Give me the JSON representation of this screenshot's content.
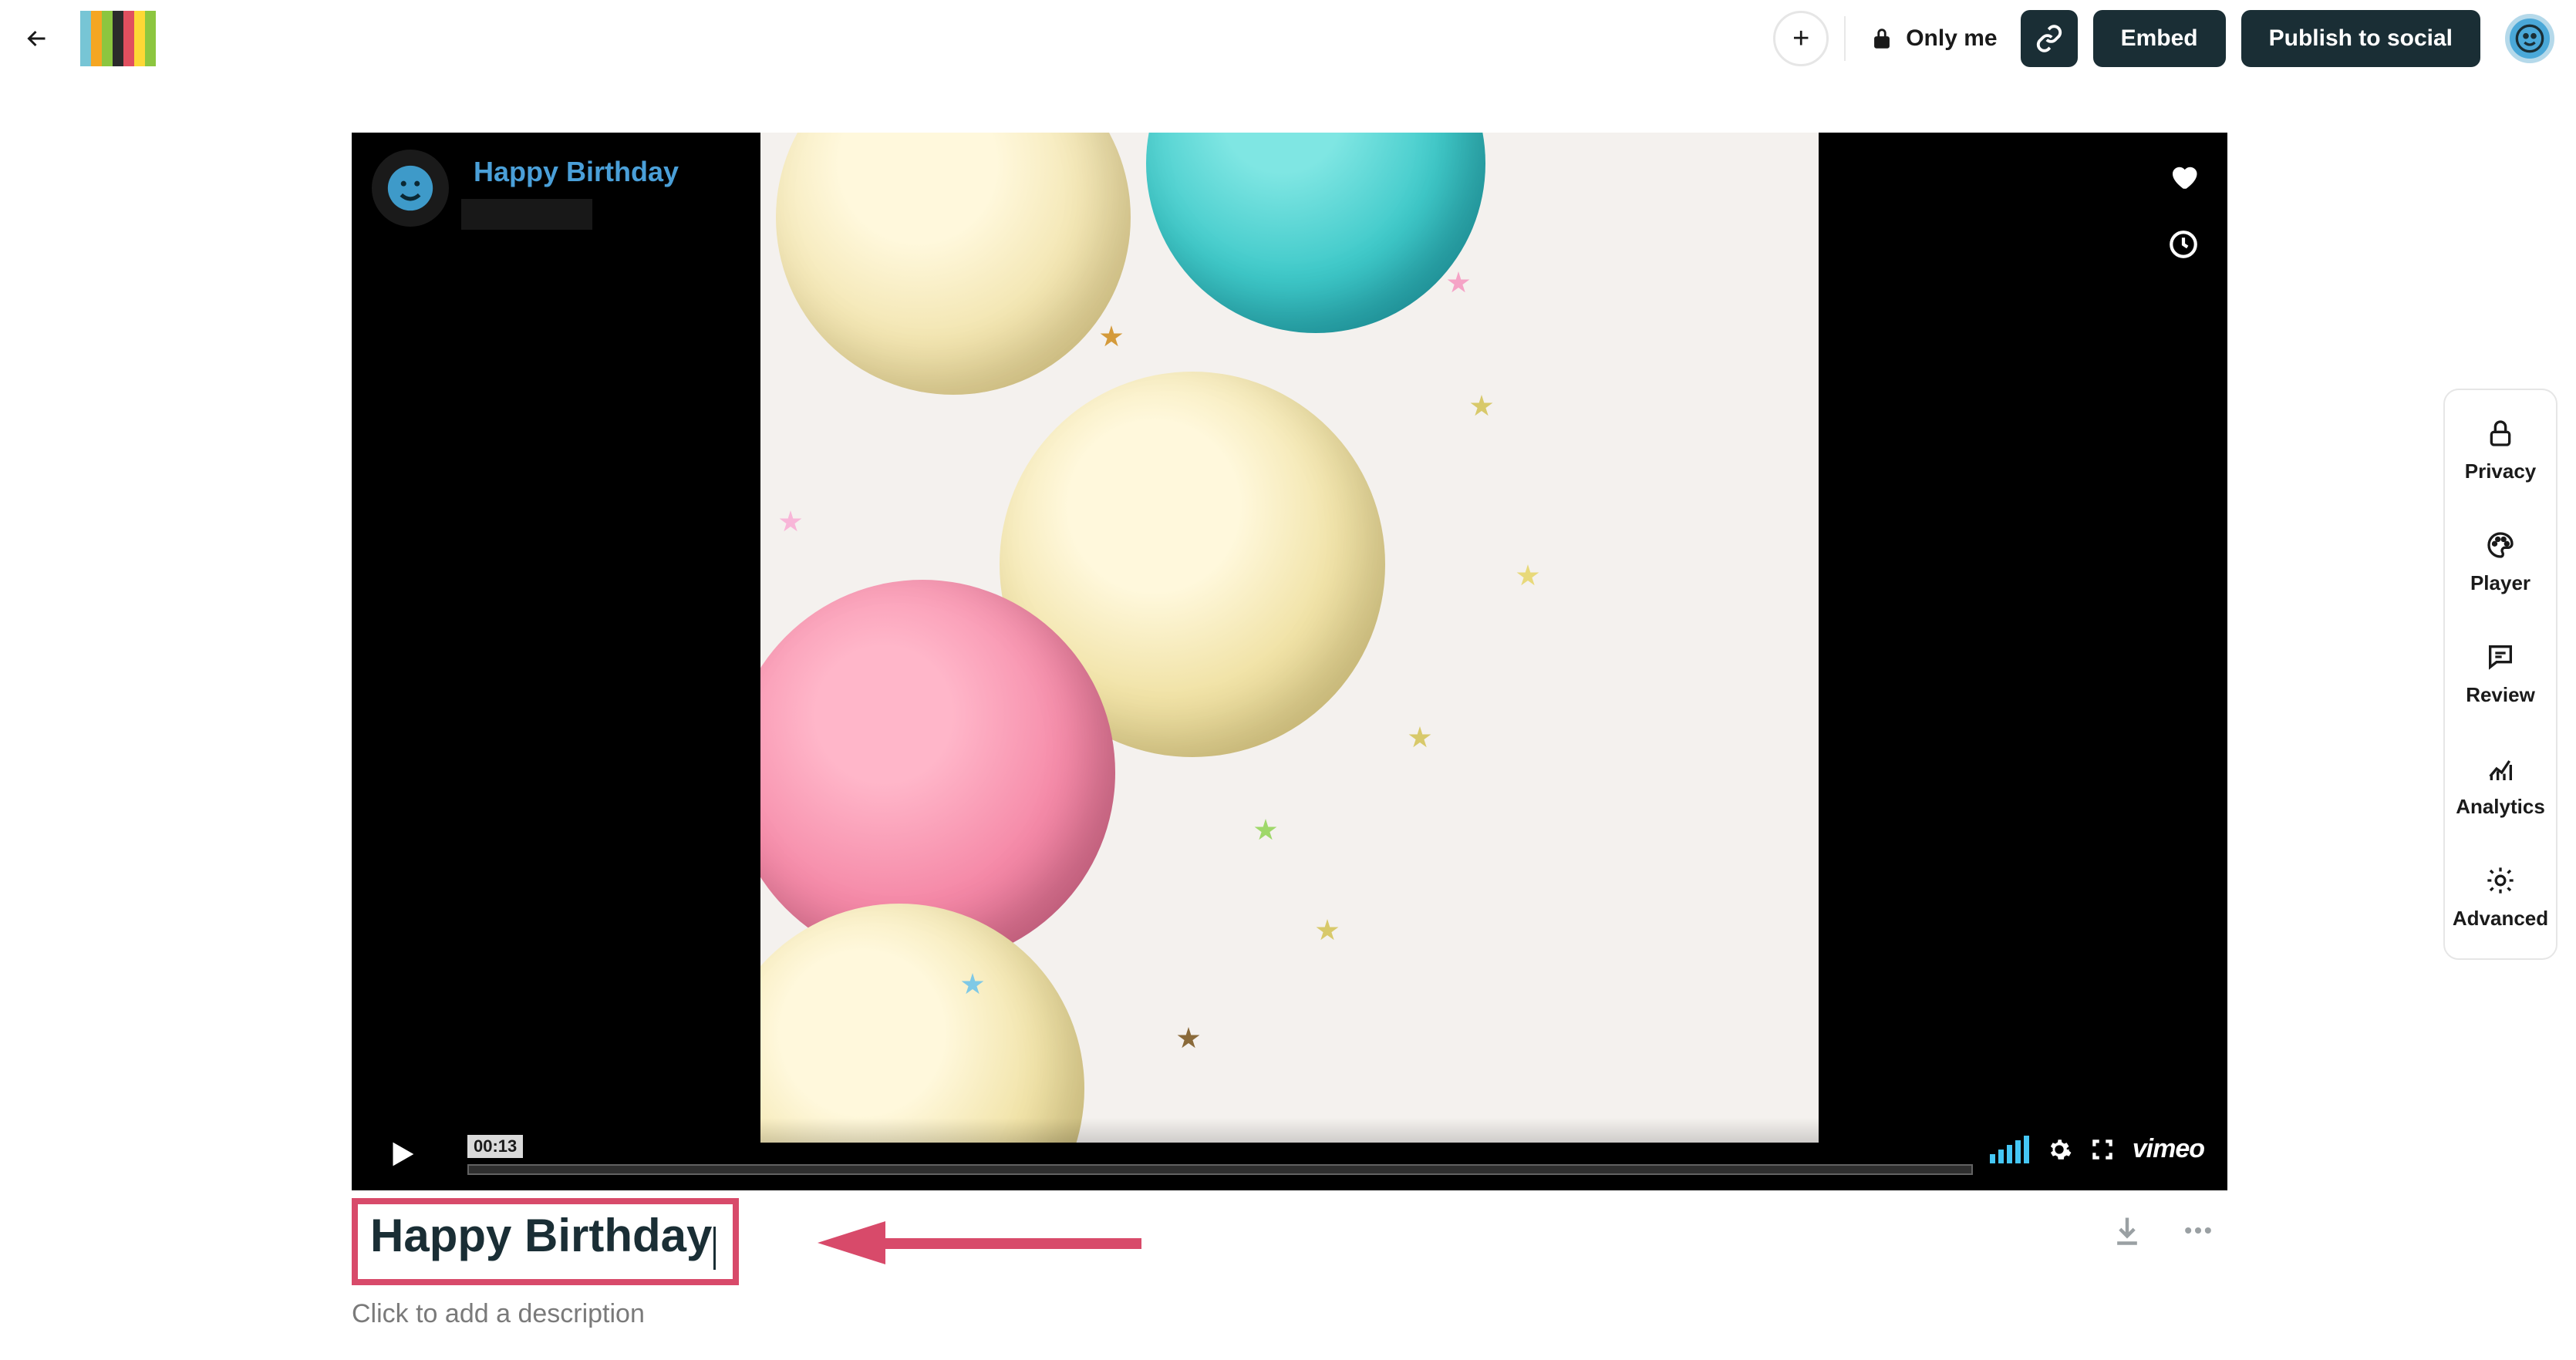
{
  "topbar": {
    "plus_label": "+",
    "privacy_label": "Only me",
    "embed_label": "Embed",
    "publish_label": "Publish to social"
  },
  "video": {
    "overlay_title": "Happy Birthday",
    "time": "00:13",
    "brand": "vimeo"
  },
  "below": {
    "title_value": "Happy Birthday",
    "description_placeholder": "Click to add a description"
  },
  "sidebar": {
    "items": [
      {
        "label": "Privacy"
      },
      {
        "label": "Player"
      },
      {
        "label": "Review"
      },
      {
        "label": "Analytics"
      },
      {
        "label": "Advanced"
      }
    ]
  }
}
